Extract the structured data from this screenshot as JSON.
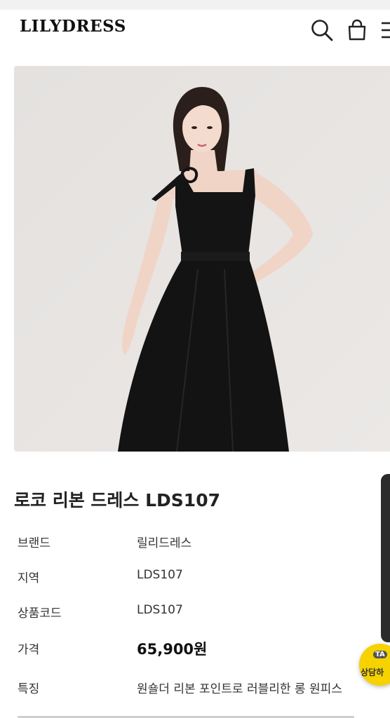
{
  "header": {
    "logo": "LILYDRESS",
    "icons": [
      "search-icon",
      "shopping-bag-icon",
      "menu-icon"
    ]
  },
  "product": {
    "title": "로코 리본 드레스 LDS107",
    "image": "model-black-dress-photo",
    "info": [
      {
        "label": "브랜드",
        "value": "릴리드레스"
      },
      {
        "label": "지역",
        "value": "LDS107"
      },
      {
        "label": "상품코드",
        "value": "LDS107"
      },
      {
        "label": "가격",
        "value": "65,900원"
      },
      {
        "label": "특징",
        "value": "원숄더 리본 포인트로 러블리한 롱 원피스"
      }
    ]
  },
  "chat": {
    "badge": "TA",
    "label": "상담하"
  },
  "colors": {
    "background": "#ffffff",
    "text": "#222222",
    "chat": "#f5d200",
    "dress": "#111111",
    "photo_bg": "#e8e5e3"
  }
}
